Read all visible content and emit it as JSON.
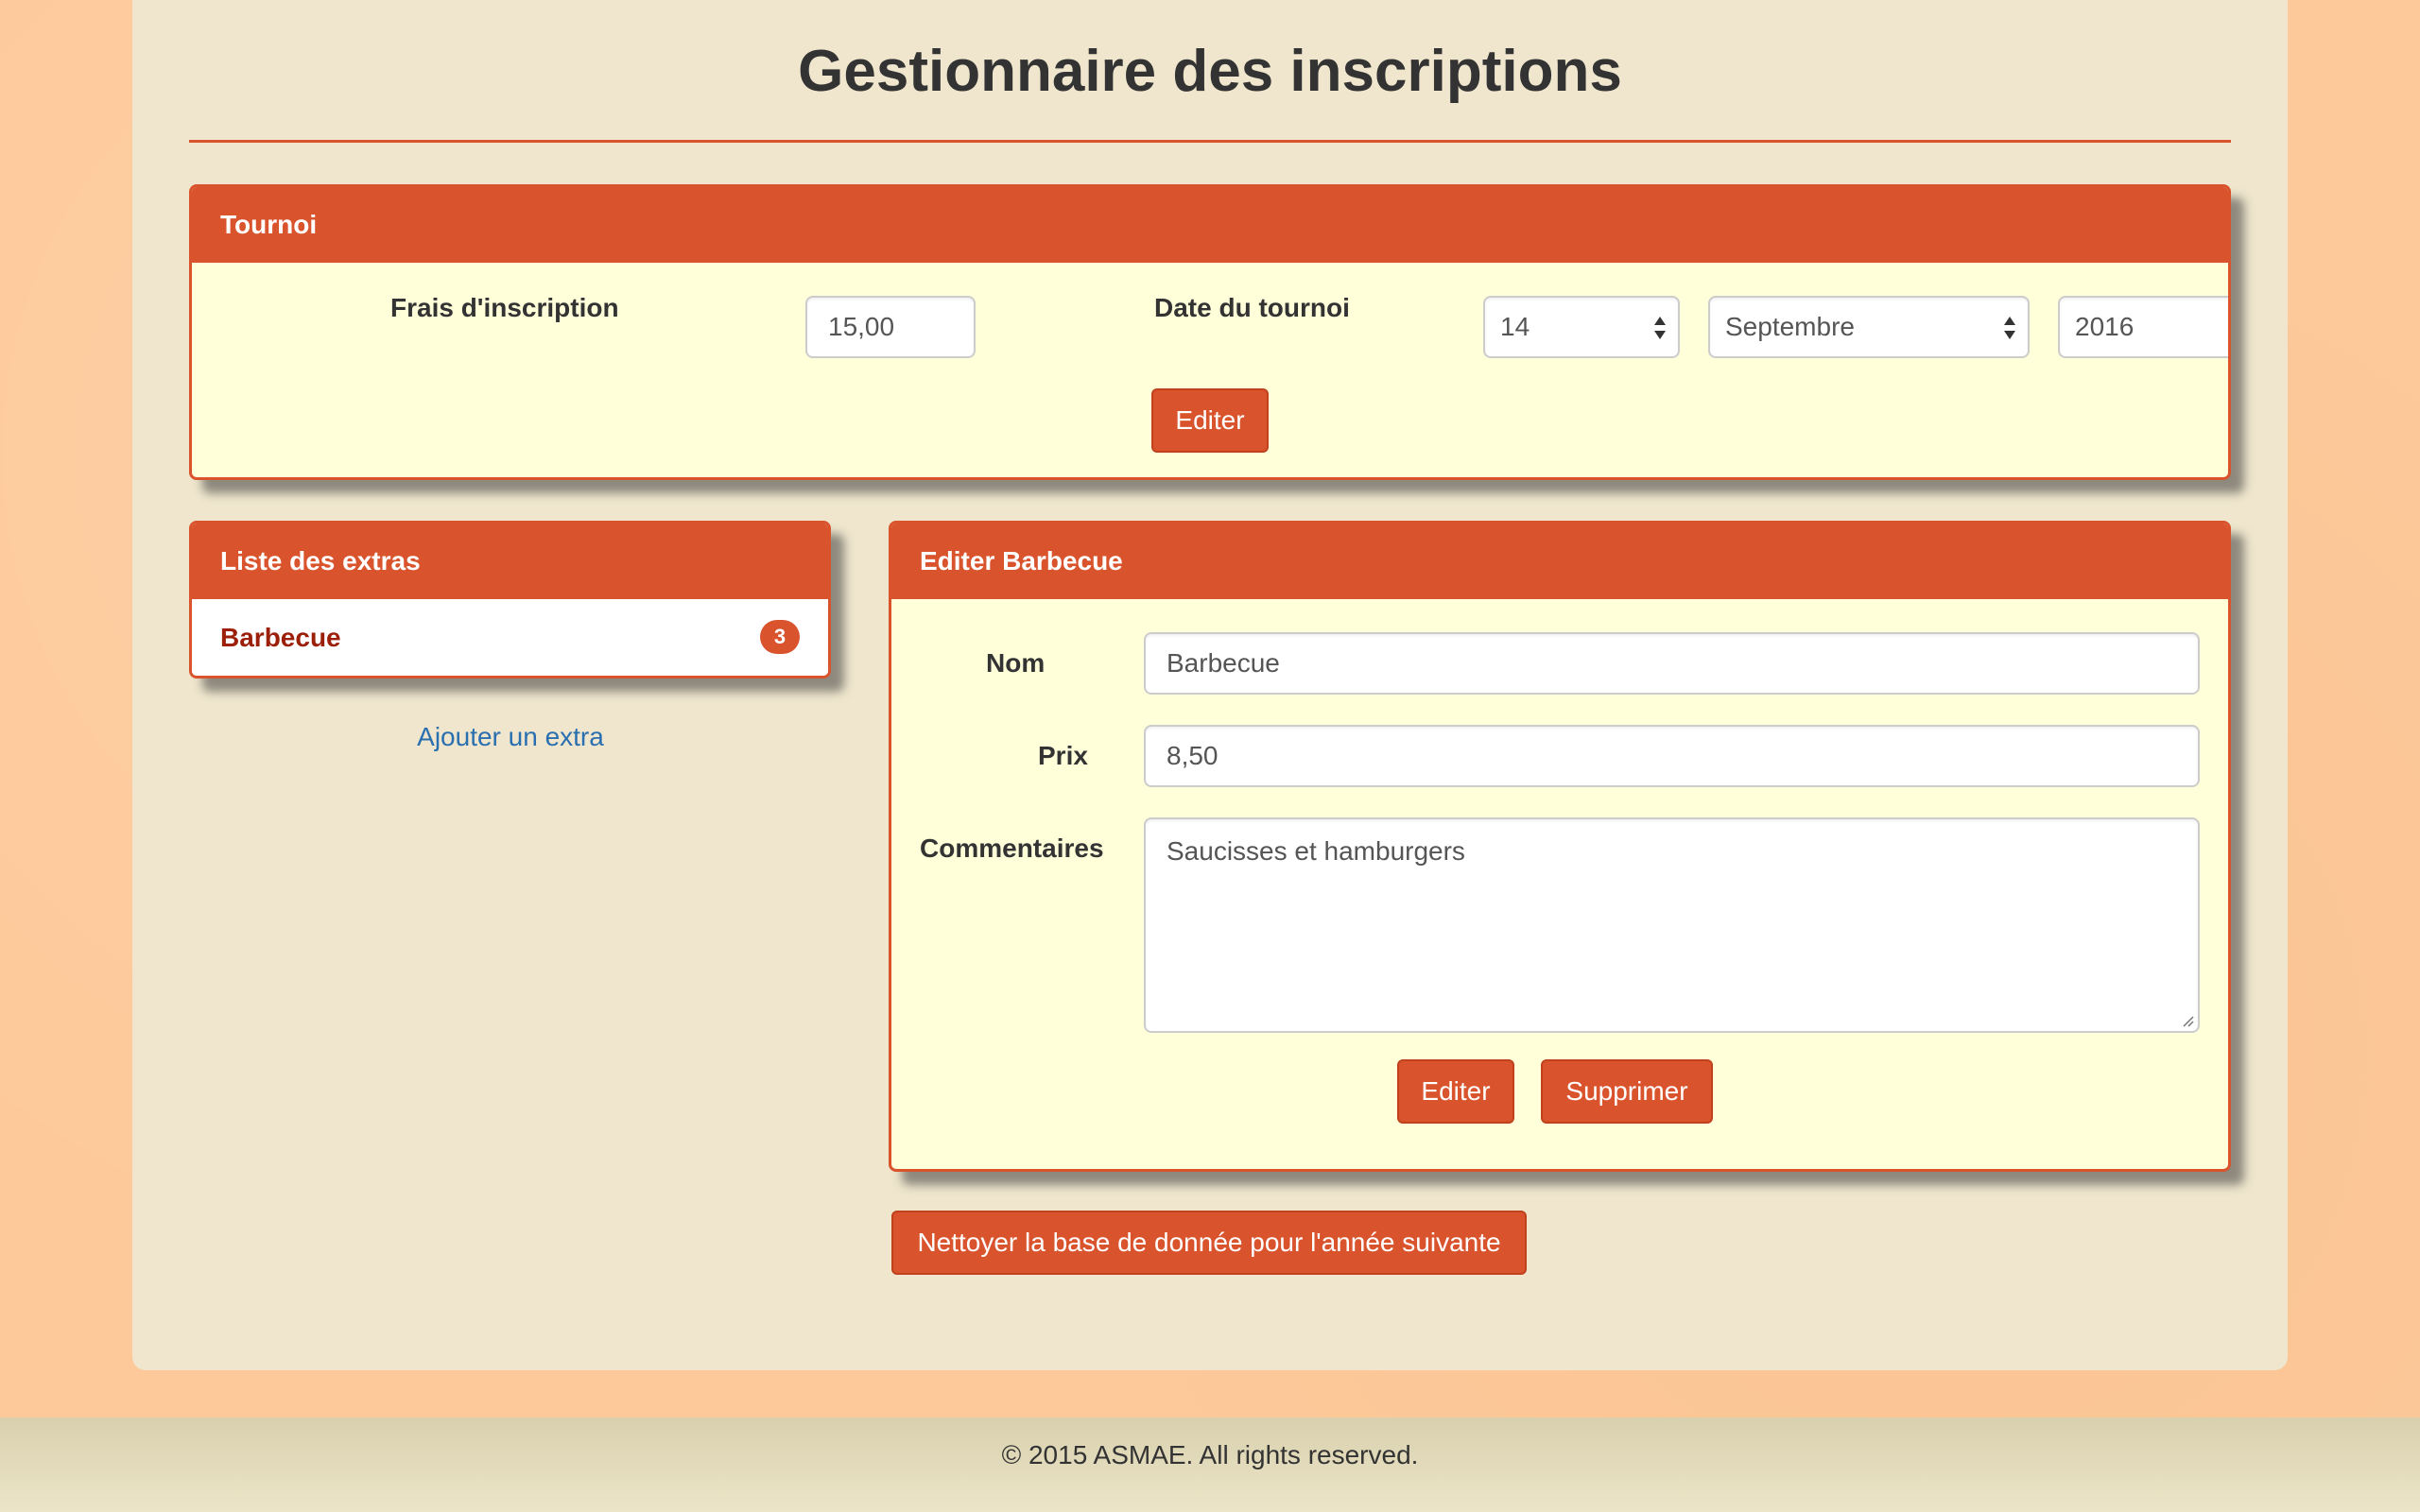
{
  "page": {
    "title": "Gestionnaire des inscriptions"
  },
  "tournoi": {
    "heading": "Tournoi",
    "fee_label": "Frais d'inscription",
    "fee_value": "15,00",
    "date_label": "Date du tournoi",
    "day": "14",
    "month": "Septembre",
    "year": "2016",
    "edit_button": "Editer"
  },
  "extras": {
    "heading": "Liste des extras",
    "items": [
      {
        "label": "Barbecue",
        "count": "3"
      }
    ],
    "add_link": "Ajouter un extra"
  },
  "edit_extra": {
    "heading": "Editer Barbecue",
    "name_label": "Nom",
    "name_value": "Barbecue",
    "price_label": "Prix",
    "price_value": "8,50",
    "comments_label": "Commentaires",
    "comments_value": "Saucisses et hamburgers",
    "edit_button": "Editer",
    "delete_button": "Supprimer"
  },
  "actions": {
    "clean_database_button": "Nettoyer la base de donnée pour l'année suivante"
  },
  "footer": {
    "copyright": "© 2015 ASMAE. All rights reserved."
  },
  "colors": {
    "accent": "#d9532d",
    "panel_body": "#ffffda",
    "container": "#efe6cd",
    "page_background": "#fdc99a",
    "link": "#2a6fb0",
    "item_text": "#9c1f0a"
  },
  "icons": {
    "select_arrow": "up-down-arrows-icon",
    "resize_grip": "resize-grip-icon"
  }
}
